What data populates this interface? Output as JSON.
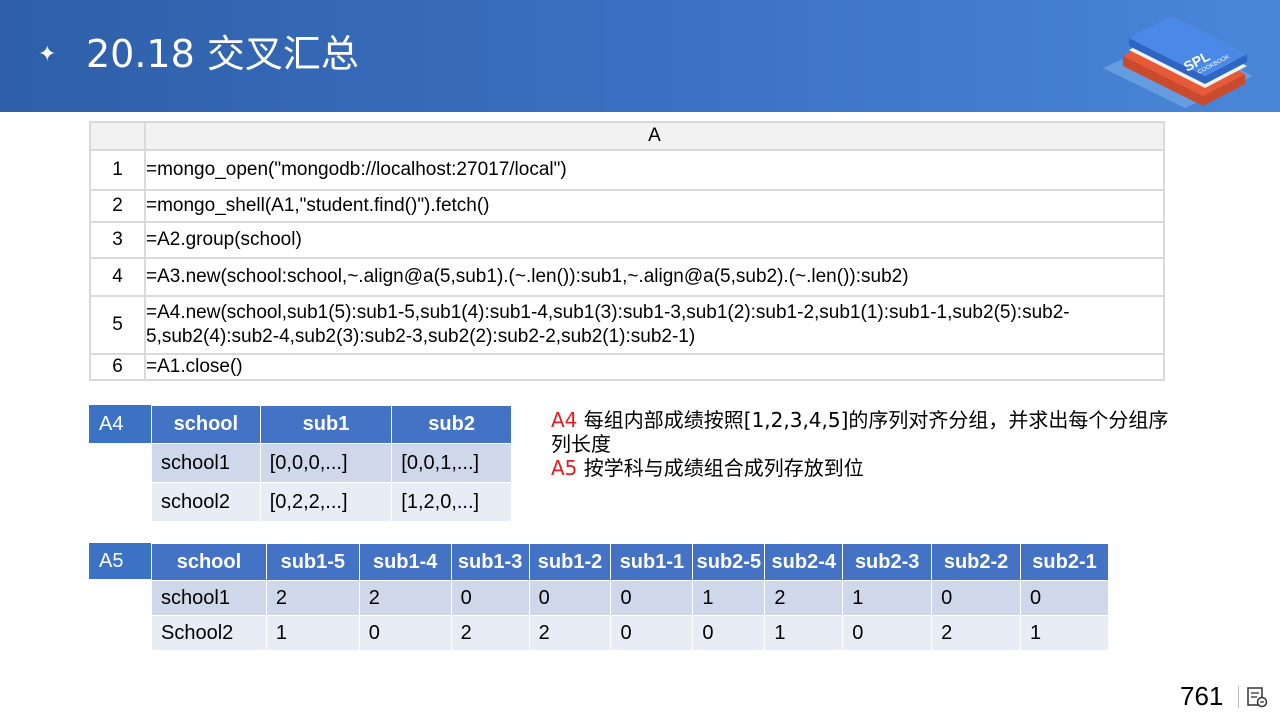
{
  "header": {
    "title": "20.18 交叉汇总",
    "bullet": "✦"
  },
  "logo": {
    "text1": "SPL",
    "text2": "COOKBOOK"
  },
  "code_grid": {
    "column_header": "A",
    "rows": [
      {
        "num": "1",
        "code": "=mongo_open(\"mongodb://localhost:27017/local\")"
      },
      {
        "num": "2",
        "code": "=mongo_shell(A1,\"student.find()\").fetch()"
      },
      {
        "num": "3",
        "code": "=A2.group(school)"
      },
      {
        "num": "4",
        "code": "=A3.new(school:school,~.align@a(5,sub1).(~.len()):sub1,~.align@a(5,sub2).(~.len()):sub2)"
      },
      {
        "num": "5",
        "code": "=A4.new(school,sub1(5):sub1-5,sub1(4):sub1-4,sub1(3):sub1-3,sub1(2):sub1-2,sub1(1):sub1-1,sub2(5):sub2-5,sub2(4):sub2-4,sub2(3):sub2-3,sub2(2):sub2-2,sub2(1):sub2-1)"
      },
      {
        "num": "6",
        "code": "=A1.close()"
      }
    ]
  },
  "a4_table": {
    "tag": "A4",
    "headers": [
      "school",
      "sub1",
      "sub2"
    ],
    "rows": [
      [
        "school1",
        "[0,0,0,...]",
        "[0,0,1,...]"
      ],
      [
        "school2",
        "[0,2,2,...]",
        "[1,2,0,...]"
      ]
    ]
  },
  "a5_table": {
    "tag": "A5",
    "headers": [
      "school",
      "sub1-5",
      "sub1-4",
      "sub1-3",
      "sub1-2",
      "sub1-1",
      "sub2-5",
      "sub2-4",
      "sub2-3",
      "sub2-2",
      "sub2-1"
    ],
    "rows": [
      [
        "school1",
        "2",
        "2",
        "0",
        "0",
        "0",
        "1",
        "2",
        "1",
        "0",
        "0"
      ],
      [
        "School2",
        "1",
        "0",
        "2",
        "2",
        "0",
        "0",
        "1",
        "0",
        "2",
        "1"
      ]
    ]
  },
  "notes": {
    "a4_label": "A4",
    "a4_text": " 每组内部成绩按照[1,2,3,4,5]的序列对齐分组，并求出每个分组序列长度",
    "a5_label": "A5",
    "a5_text": " 按学科与成绩组合成列存放到位"
  },
  "footer": {
    "page_number": "761"
  },
  "colors": {
    "header_blue": "#2e5fa8",
    "table_header": "#4472c4",
    "row_dark": "#cfd8ea",
    "row_light": "#e8ecf5",
    "note_red": "#e02020"
  }
}
